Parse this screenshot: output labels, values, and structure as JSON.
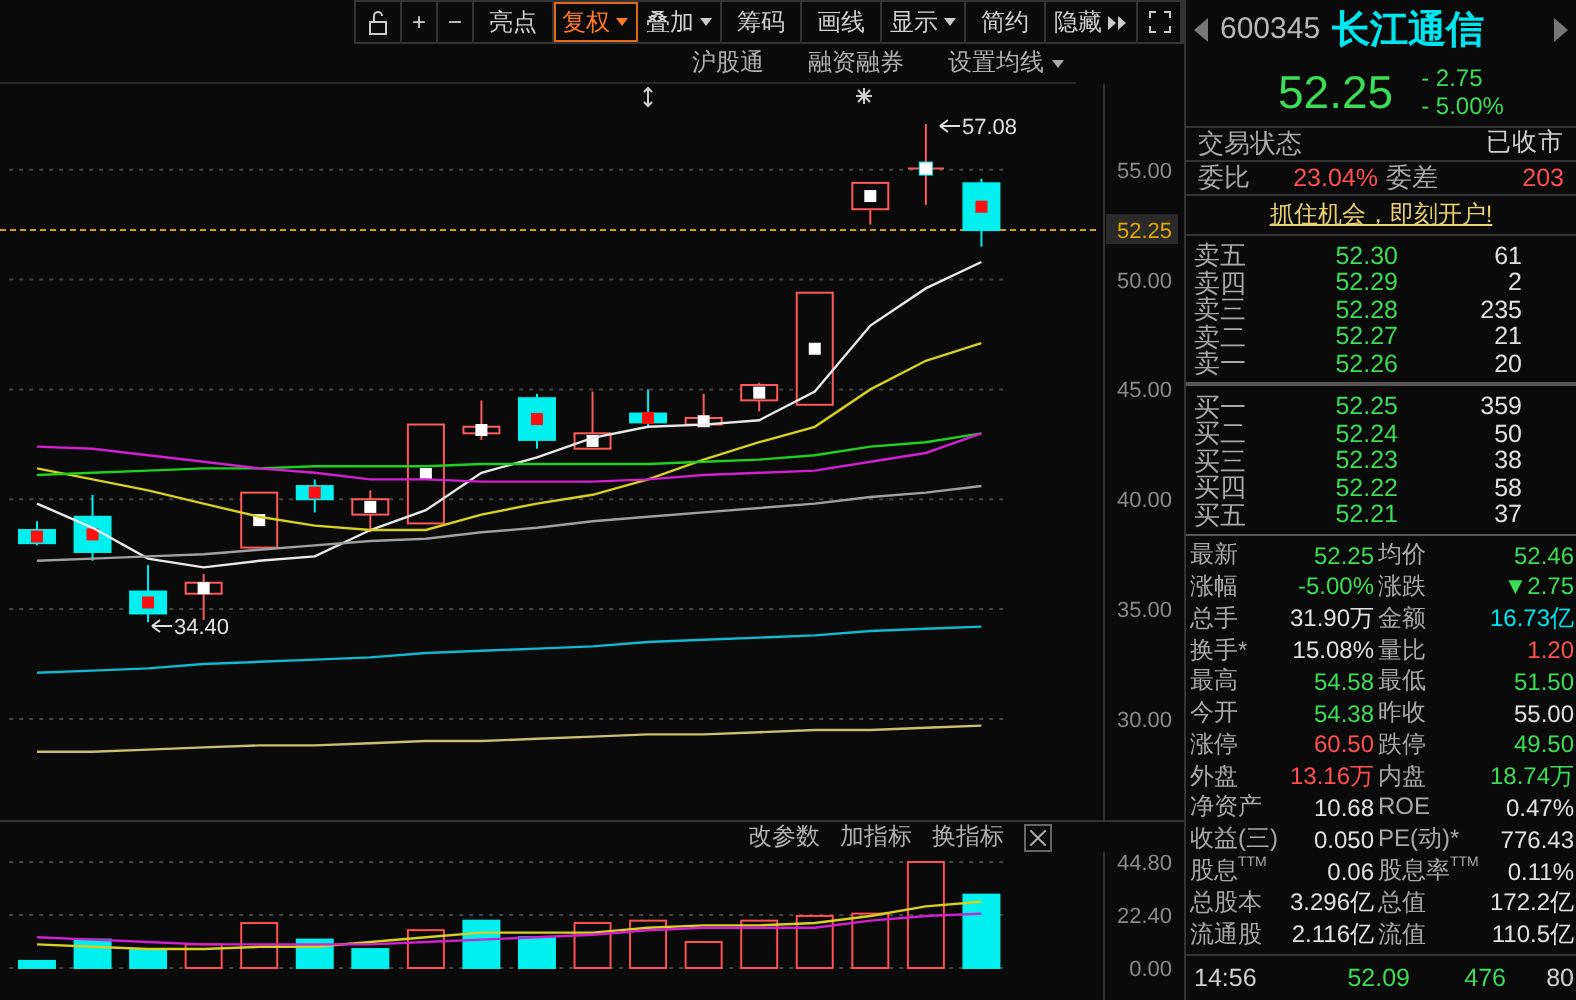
{
  "toolbar": {
    "items": [
      {
        "label": "+",
        "selected": false,
        "dropdown": false
      },
      {
        "label": "−",
        "selected": false,
        "dropdown": false
      },
      {
        "label": "亮点",
        "selected": false,
        "dropdown": false
      },
      {
        "label": "复权",
        "selected": true,
        "dropdown": true
      },
      {
        "label": "叠加",
        "selected": false,
        "dropdown": true
      },
      {
        "label": "筹码",
        "selected": false,
        "dropdown": false
      },
      {
        "label": "画线",
        "selected": false,
        "dropdown": false
      },
      {
        "label": "显示",
        "selected": false,
        "dropdown": true
      },
      {
        "label": "简约",
        "selected": false,
        "dropdown": false
      },
      {
        "label": "隐藏",
        "selected": false,
        "dropdown": false
      }
    ]
  },
  "chart_header": {
    "links": [
      "沪股通",
      "融资融券"
    ],
    "ma_setting": "设置均线"
  },
  "price_chart": {
    "high_marker": "57.08",
    "low_marker": "34.40",
    "chart_data": {
      "type": "candlestick",
      "grid": true,
      "ylim": [
        25.4,
        58.9
      ],
      "ref_lines": [
        {
          "axis": "y",
          "value": 52.25,
          "label": "52.25"
        }
      ],
      "categories": [
        null,
        null,
        null,
        null,
        null,
        null,
        null,
        null,
        null,
        null,
        null,
        null,
        null,
        null,
        null,
        null,
        null,
        null
      ],
      "ohlc": [
        [
          38.6,
          39.0,
          37.9,
          38.0
        ],
        [
          39.2,
          40.2,
          37.2,
          37.6
        ],
        [
          35.8,
          37.0,
          34.4,
          34.8
        ],
        [
          35.7,
          36.6,
          34.5,
          36.2
        ],
        [
          37.8,
          40.3,
          37.8,
          40.3
        ],
        [
          40.6,
          40.9,
          39.4,
          40.0
        ],
        [
          39.3,
          40.4,
          38.5,
          40.0
        ],
        [
          38.9,
          43.4,
          38.9,
          43.4
        ],
        [
          43.0,
          44.5,
          42.7,
          43.3
        ],
        [
          44.6,
          44.8,
          42.3,
          42.7
        ],
        [
          42.3,
          44.9,
          42.3,
          43.0
        ],
        [
          43.9,
          45.0,
          43.3,
          43.5
        ],
        [
          43.4,
          44.8,
          43.3,
          43.7
        ],
        [
          44.5,
          45.3,
          44.0,
          45.2
        ],
        [
          44.3,
          49.4,
          44.3,
          49.4
        ],
        [
          53.2,
          54.4,
          52.5,
          54.4
        ],
        [
          55.1,
          57.08,
          53.4,
          55.0
        ],
        [
          54.38,
          54.58,
          51.5,
          52.25
        ]
      ],
      "yticks": [
        {
          "value": 55,
          "label": "55.00"
        },
        {
          "value": 50,
          "label": "50.00"
        },
        {
          "value": 45,
          "label": "45.00"
        },
        {
          "value": 40,
          "label": "40.00"
        },
        {
          "value": 35,
          "label": "35.00"
        },
        {
          "value": 30,
          "label": "30.00"
        }
      ],
      "series": [
        {
          "type": "line",
          "color": "#e8e8e8",
          "values": [
            39.8,
            38.7,
            37.3,
            36.9,
            37.2,
            37.4,
            38.6,
            39.5,
            41.2,
            41.9,
            42.8,
            43.3,
            43.4,
            43.6,
            44.9,
            47.9,
            49.6,
            50.8
          ]
        },
        {
          "type": "line",
          "color": "#d8d020",
          "values": [
            41.4,
            40.9,
            40.4,
            39.8,
            39.2,
            38.8,
            38.6,
            38.6,
            39.3,
            39.8,
            40.2,
            40.9,
            41.8,
            42.6,
            43.3,
            45.0,
            46.3,
            47.1
          ]
        },
        {
          "type": "line",
          "color": "#20d020",
          "values": [
            41.1,
            41.2,
            41.3,
            41.4,
            41.4,
            41.5,
            41.5,
            41.5,
            41.6,
            41.6,
            41.6,
            41.6,
            41.7,
            41.8,
            42.0,
            42.4,
            42.6,
            43.0
          ]
        },
        {
          "type": "line",
          "color": "#d020d0",
          "values": [
            42.4,
            42.3,
            42.0,
            41.7,
            41.4,
            41.2,
            40.9,
            40.9,
            40.8,
            40.8,
            40.8,
            40.9,
            41.1,
            41.2,
            41.3,
            41.7,
            42.1,
            43.0
          ]
        },
        {
          "type": "line",
          "color": "#a0a0a0",
          "values": [
            37.2,
            37.3,
            37.4,
            37.5,
            37.7,
            37.9,
            38.1,
            38.2,
            38.5,
            38.7,
            39.0,
            39.2,
            39.4,
            39.6,
            39.8,
            40.1,
            40.3,
            40.6
          ]
        },
        {
          "type": "line",
          "color": "#10b8d0",
          "values": [
            32.1,
            32.2,
            32.3,
            32.5,
            32.6,
            32.7,
            32.8,
            33.0,
            33.1,
            33.2,
            33.3,
            33.5,
            33.6,
            33.7,
            33.8,
            34.0,
            34.1,
            34.2
          ]
        },
        {
          "type": "line",
          "color": "#c8c070",
          "values": [
            28.5,
            28.5,
            28.6,
            28.7,
            28.8,
            28.8,
            28.9,
            29.0,
            29.0,
            29.1,
            29.2,
            29.3,
            29.3,
            29.4,
            29.5,
            29.5,
            29.6,
            29.7
          ]
        }
      ]
    }
  },
  "volume_panel": {
    "actions": [
      "改参数",
      "加指标",
      "换指标"
    ],
    "chart_data": {
      "type": "bar",
      "yticks": [
        {
          "value": 0,
          "label": "0.00"
        },
        {
          "value": 22.4,
          "label": "22.40"
        },
        {
          "value": 44.8,
          "label": "44.80"
        }
      ],
      "ylim": [
        0,
        44.8
      ],
      "series": [
        {
          "color": "#ff5050",
          "values": [
            null,
            null,
            null,
            10,
            19,
            null,
            null,
            16,
            null,
            null,
            19,
            20,
            11,
            20,
            22,
            23,
            44.8,
            null
          ]
        },
        {
          "color": "#00f0f0",
          "values": [
            3,
            12,
            8,
            null,
            null,
            12,
            8,
            null,
            20,
            13,
            null,
            null,
            null,
            null,
            null,
            null,
            null,
            31
          ]
        },
        {
          "type": "line",
          "color": "#d8d020",
          "values": [
            10,
            9,
            8,
            8,
            9,
            9,
            11,
            13,
            15,
            15,
            15,
            17,
            18,
            18,
            19,
            22,
            26,
            28
          ]
        },
        {
          "type": "line",
          "color": "#d020d0",
          "values": [
            13,
            12,
            11,
            10,
            10,
            10,
            10,
            11,
            12,
            13,
            14,
            16,
            17,
            17,
            17,
            20,
            22,
            23
          ]
        }
      ]
    }
  },
  "quote": {
    "code": "600345",
    "name": "长江通信",
    "price": "52.25",
    "change": "- 2.75",
    "change_pct": "- 5.00%",
    "status_label": "交易状态",
    "status": "已收市",
    "ratio_label": "委比",
    "ratio": "23.04%",
    "diff_label": "委差",
    "diff": "203",
    "banner": "抓住机会，即刻开户!"
  },
  "asks": [
    {
      "label": "卖五",
      "price": "52.30",
      "volume": "61"
    },
    {
      "label": "卖四",
      "price": "52.29",
      "volume": "2"
    },
    {
      "label": "卖三",
      "price": "52.28",
      "volume": "235"
    },
    {
      "label": "卖二",
      "price": "52.27",
      "volume": "21"
    },
    {
      "label": "卖一",
      "price": "52.26",
      "volume": "20"
    }
  ],
  "bids": [
    {
      "label": "买一",
      "price": "52.25",
      "volume": "359"
    },
    {
      "label": "买二",
      "price": "52.24",
      "volume": "50"
    },
    {
      "label": "买三",
      "price": "52.23",
      "volume": "38"
    },
    {
      "label": "买四",
      "price": "52.22",
      "volume": "58"
    },
    {
      "label": "买五",
      "price": "52.21",
      "volume": "37"
    }
  ],
  "stats": [
    [
      {
        "label": "最新",
        "value": "52.25",
        "color": "#3ddc56"
      },
      {
        "label": "均价",
        "value": "52.46",
        "color": "#3ddc56"
      }
    ],
    [
      {
        "label": "涨幅",
        "value": "-5.00%",
        "color": "#3ddc56"
      },
      {
        "label": "涨跌",
        "value": "▼2.75",
        "color": "#3ddc56"
      }
    ],
    [
      {
        "label": "总手",
        "value": "31.90万",
        "color": "#e0e0e0"
      },
      {
        "label": "金额",
        "value": "16.73亿",
        "color": "#00e5ee"
      }
    ],
    [
      {
        "label": "换手*",
        "value": "15.08%",
        "color": "#e0e0e0"
      },
      {
        "label": "量比",
        "value": "1.20",
        "color": "#ff5050"
      }
    ],
    [
      {
        "label": "最高",
        "value": "54.58",
        "color": "#3ddc56"
      },
      {
        "label": "最低",
        "value": "51.50",
        "color": "#3ddc56"
      }
    ],
    [
      {
        "label": "今开",
        "value": "54.38",
        "color": "#3ddc56"
      },
      {
        "label": "昨收",
        "value": "55.00",
        "color": "#e0e0e0"
      }
    ],
    [
      {
        "label": "涨停",
        "value": "60.50",
        "color": "#ff5050"
      },
      {
        "label": "跌停",
        "value": "49.50",
        "color": "#3ddc56"
      }
    ],
    [
      {
        "label": "外盘",
        "value": "13.16万",
        "color": "#ff5050"
      },
      {
        "label": "内盘",
        "value": "18.74万",
        "color": "#3ddc56"
      }
    ],
    [
      {
        "label": "净资产",
        "value": "10.68",
        "color": "#e0e0e0"
      },
      {
        "label": "ROE",
        "value": "0.47%",
        "color": "#e0e0e0"
      }
    ],
    [
      {
        "label": "收益(三)",
        "value": "0.050",
        "color": "#e0e0e0"
      },
      {
        "label": "PE(动)*",
        "value": "776.43",
        "color": "#e0e0e0"
      }
    ],
    [
      {
        "label": "股息$^{TTM}$",
        "value": "0.06",
        "color": "#e0e0e0"
      },
      {
        "label": "股息率$^{TTM}$",
        "value": "0.11%",
        "color": "#e0e0e0"
      }
    ],
    [
      {
        "label": "总股本",
        "value": "3.296亿",
        "color": "#e0e0e0"
      },
      {
        "label": "总值",
        "value": "172.2亿",
        "color": "#e0e0e0"
      }
    ],
    [
      {
        "label": "流通股",
        "value": "2.116亿",
        "color": "#e0e0e0"
      },
      {
        "label": "流值",
        "value": "110.5亿",
        "color": "#e0e0e0"
      }
    ]
  ],
  "ticker": {
    "time": "14:56",
    "price": "52.09",
    "volume": "476",
    "count": "80"
  }
}
